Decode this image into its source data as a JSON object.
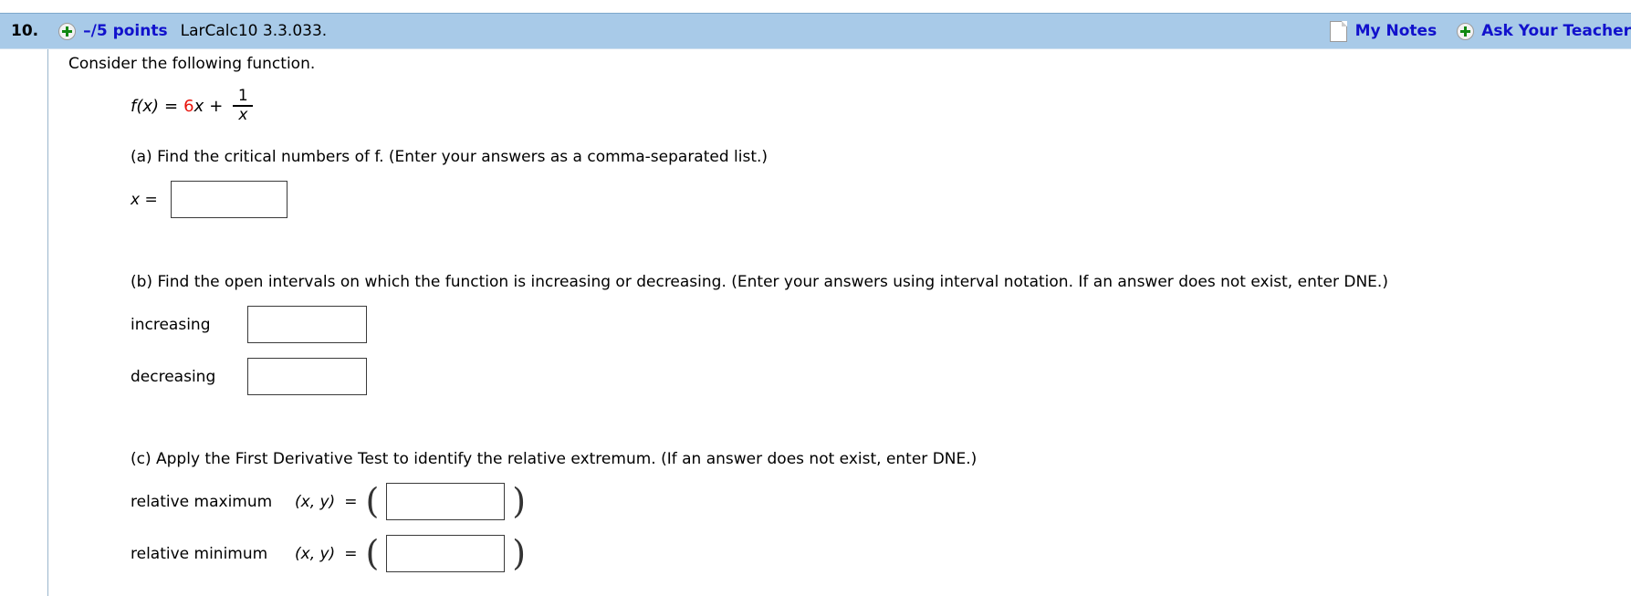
{
  "header": {
    "question_number": "10.",
    "plus_icon": "plus-circle-icon",
    "points": "–/5 points",
    "question_code": "LarCalc10 3.3.033.",
    "notes_icon": "document-icon",
    "my_notes_label": "My Notes",
    "ask_plus_icon": "plus-circle-icon",
    "ask_teacher_label": "Ask Your Teacher",
    "bar_color": "#a8cae8",
    "link_color": "#1111cc"
  },
  "problem": {
    "intro": "Consider the following function.",
    "function": {
      "lhs": "f(x)",
      "equals": "=",
      "coefficient": "6",
      "coefficient_color": "#e8140c",
      "variable": "x",
      "plus": "+",
      "fraction_numerator": "1",
      "fraction_denominator": "x"
    },
    "parts": [
      {
        "id": "a",
        "prompt": "(a) Find the critical numbers of f. (Enter your answers as a comma-separated list.)",
        "rows": [
          {
            "label": "x =",
            "value": "",
            "placeholder": ""
          }
        ]
      },
      {
        "id": "b",
        "prompt": "(b) Find the open intervals on which the function is increasing or decreasing. (Enter your answers using interval notation. If an answer does not exist, enter DNE.)",
        "rows": [
          {
            "label": "increasing",
            "value": "",
            "placeholder": ""
          },
          {
            "label": "decreasing",
            "value": "",
            "placeholder": ""
          }
        ]
      },
      {
        "id": "c",
        "prompt": "(c) Apply the First Derivative Test to identify the relative extremum. (If an answer does not exist, enter DNE.)",
        "xy_label": "(x, y)",
        "equals": "=",
        "open_paren": "(",
        "close_paren": ")",
        "rows": [
          {
            "label": "relative maximum",
            "value": "",
            "placeholder": ""
          },
          {
            "label": "relative minimum",
            "value": "",
            "placeholder": ""
          }
        ]
      }
    ]
  }
}
